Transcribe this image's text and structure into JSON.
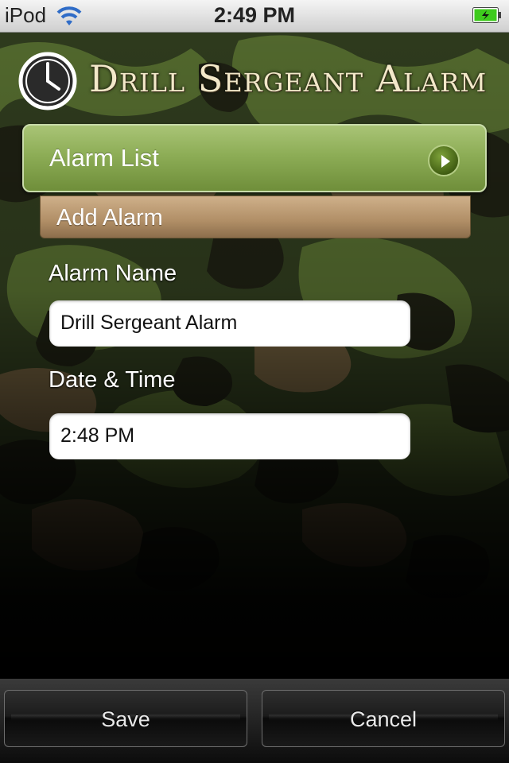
{
  "status_bar": {
    "carrier": "iPod",
    "time": "2:49 PM"
  },
  "header": {
    "title": "Drill Sergeant Alarm"
  },
  "nav": {
    "alarm_list_label": "Alarm List",
    "add_alarm_label": "Add Alarm"
  },
  "form": {
    "alarm_name_label": "Alarm Name",
    "alarm_name_value": "Drill Sergeant Alarm",
    "date_time_label": "Date & Time",
    "date_time_value": "2:48 PM"
  },
  "toolbar": {
    "save_label": "Save",
    "cancel_label": "Cancel"
  },
  "colors": {
    "accent_green": "#8dad56",
    "tab_tan": "#b08e66",
    "battery_green": "#3ecb1d"
  }
}
